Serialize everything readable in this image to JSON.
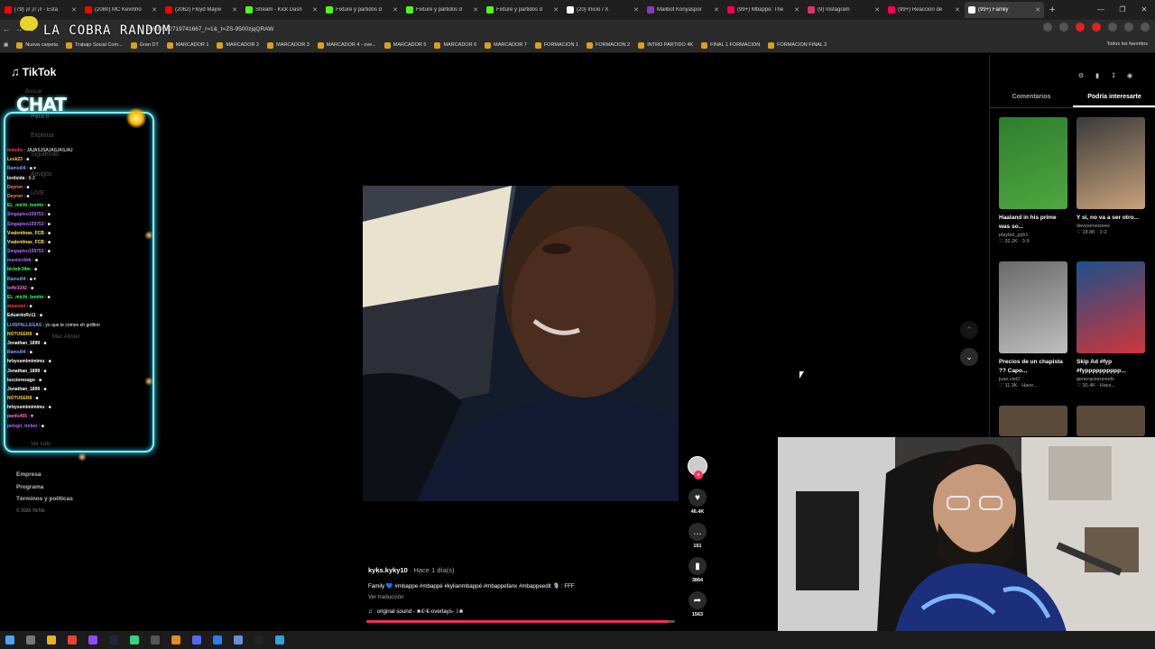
{
  "browser": {
    "tabs": [
      {
        "title": "(79) ¡i! ¡i! ¡i! - Esta",
        "color": "#ff0000"
      },
      {
        "title": "(2080) MC Kevinho",
        "color": "#ff0000"
      },
      {
        "title": "(2062) Floyd Mayw",
        "color": "#ff0000"
      },
      {
        "title": "Stream - Kick Dash",
        "color": "#53fc18"
      },
      {
        "title": "Fixture y partidos d",
        "color": "#53fc18"
      },
      {
        "title": "Fixture y partidos d",
        "color": "#53fc18"
      },
      {
        "title": "Fixture y partidos d",
        "color": "#53fc18"
      },
      {
        "title": "(20) Inicio / X",
        "color": "#ffffff"
      },
      {
        "title": "Mailbot Konyaspor",
        "color": "#8a3ab9"
      },
      {
        "title": "(99+) Mbappé: The",
        "color": "#ff0050"
      },
      {
        "title": "(9) Instagram",
        "color": "#e1306c"
      },
      {
        "title": "(99+) Reacción de",
        "color": "#ff0050"
      },
      {
        "title": "(99+) Family",
        "color": "#ffffff",
        "active": true
      }
    ],
    "new_tab": "+",
    "window_controls": [
      "—",
      "❐",
      "✕"
    ],
    "url": "096092327197416​67_r=1&_t=ZS-9500zjqQRAW",
    "overlay_title": "LA COBRA RANDOM",
    "bookmarks": [
      "Nueva carpeta",
      "Trabajo Social Com...",
      "Gran DT",
      "MARCADOR 1",
      "MARCADOR 2",
      "MARCADOR 3",
      "MARCADOR 4 - ove...",
      "MARCADOR 5",
      "MARCADOR 6",
      "MARCADOR 7",
      "FORMACION 1",
      "FORMACION 2",
      "INTRO PARTIDO 4K",
      "FINAL 1 FORMACION",
      "FORMACION FINAL 2"
    ],
    "all_bookmarks": "Todos los favoritos"
  },
  "tiktok": {
    "logo": "TikTok",
    "search_placeholder": "Buscar",
    "ghost_menu": [
      "Para ti",
      "Explorar",
      "Siguiendo",
      "Amigos",
      "LIVE"
    ],
    "ghost_follow": "Mac Allister",
    "see_all": "Ver todo",
    "footer": [
      "Empresa",
      "Programa",
      "Términos y políticas"
    ],
    "copyright": "© 2026 TikTok"
  },
  "chat": {
    "title": "CHAT",
    "accent": "#7ef2ff",
    "messages": [
      {
        "user": "fedsdls",
        "color": "#ff3b3b",
        "text": "JAJASJSAJASJASJAJ"
      },
      {
        "user": "Lesk23",
        "color": "#ffd23a",
        "text": "■"
      },
      {
        "user": "Ramsi04",
        "color": "#7aa6ff",
        "text": "■ ♥"
      },
      {
        "user": "lordsida",
        "color": "#ffffff",
        "text": "6-2"
      },
      {
        "user": "Deyron",
        "color": "#ff8a3a",
        "text": "■"
      },
      {
        "user": "Deyron",
        "color": "#ff8a3a",
        "text": "■"
      },
      {
        "user": "EL_michi_bonito",
        "color": "#45ff64",
        "text": "■"
      },
      {
        "user": "Singapiso159753",
        "color": "#b36bff",
        "text": "■"
      },
      {
        "user": "Singapiso159753",
        "color": "#b36bff",
        "text": "■"
      },
      {
        "user": "Vvalentinas_FCB",
        "color": "#ffe65a",
        "text": "■"
      },
      {
        "user": "Vvalentinas_FCB",
        "color": "#ffe65a",
        "text": "■"
      },
      {
        "user": "Singapiso159753",
        "color": "#b36bff",
        "text": "■"
      },
      {
        "user": "maxisickkk",
        "color": "#b36bff",
        "text": "■"
      },
      {
        "user": "bickdc34m",
        "color": "#45ff64",
        "text": "■"
      },
      {
        "user": "Ramsi04",
        "color": "#7aa6ff",
        "text": "■ ♥"
      },
      {
        "user": "toffe3342",
        "color": "#ff6bd5",
        "text": "■"
      },
      {
        "user": "EL_michi_bonito",
        "color": "#45ff64",
        "text": "■"
      },
      {
        "user": "atmestel",
        "color": "#ff3b3b",
        "text": "■"
      },
      {
        "user": "EduardoRz11",
        "color": "#ffffff",
        "text": "■"
      },
      {
        "user": "LUISPALLEGAS",
        "color": "#7aa6ff",
        "text": "yo que te comes eh grdltoo"
      },
      {
        "user": "NOTUSER8",
        "color": "#ffd23a",
        "text": "■"
      },
      {
        "user": "Jonathan_1899",
        "color": "#ffffff",
        "text": "■"
      },
      {
        "user": "Ramsi04",
        "color": "#7aa6ff",
        "text": "■"
      },
      {
        "user": "hrbyssmimimimu",
        "color": "#ffffff",
        "text": "■"
      },
      {
        "user": "Jonathan_1899",
        "color": "#ffffff",
        "text": "■"
      },
      {
        "user": "luccioresago",
        "color": "#ffffff",
        "text": "■"
      },
      {
        "user": "Jonathan_1899",
        "color": "#ffffff",
        "text": "■"
      },
      {
        "user": "NOTUSER8",
        "color": "#ffd23a",
        "text": "■"
      },
      {
        "user": "hrbyssmimimimu",
        "color": "#ffffff",
        "text": "■"
      },
      {
        "user": "panfu455",
        "color": "#ff6bd5",
        "text": "♥"
      },
      {
        "user": "pelegri_trebor",
        "color": "#b36bff",
        "text": "■"
      }
    ]
  },
  "video": {
    "author": "kyks.kyky10",
    "ago": "· Hace 1 día(s)",
    "caption": "Family 💙 #mbappe #mbappé #kylianmbappé #mbappefanx #mbappeedit 🎙️ : FFF",
    "translate": "Ver traducción",
    "sound": "original sound - ❀☪€-overlays-☽❀",
    "progress": 0.98,
    "likes": "46.4K",
    "comments": "161",
    "saves": "3864",
    "shares": "1563"
  },
  "right_panel": {
    "tabs": [
      "Comentarios",
      "Podría interesarte"
    ],
    "active_tab": 1,
    "cards": [
      {
        "title": "Haaland in his prime was so...",
        "author": "playboi_pyb1",
        "stats": "♡ 32.2K · 3-9",
        "colors": [
          "#2f7d2f",
          "#4fa83f"
        ]
      },
      {
        "title": "Y si, no va a ser otro...",
        "author": "davoxeneizeee",
        "stats": "♡ 18.8K · 2-2",
        "colors": [
          "#3a3a3a",
          "#c9a27a"
        ]
      },
      {
        "title": "Precios de un chapista ?? Capo...",
        "author": "juan.viel2",
        "stats": "♡ 11.3K · Hace...",
        "colors": [
          "#6a6a6a",
          "#bfbfbf"
        ]
      },
      {
        "title": "Skip Ad #fyp #fypppppppppp...",
        "author": "generacionzreels",
        "stats": "♡ 30.4K · Hace...",
        "colors": [
          "#1c4f8a",
          "#d0363a"
        ]
      }
    ]
  }
}
